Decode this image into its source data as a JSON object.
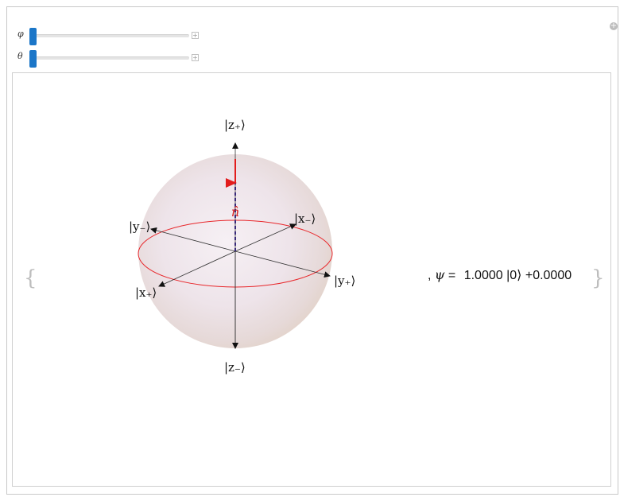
{
  "controls": {
    "phi": {
      "label": "φ",
      "value": 0
    },
    "theta": {
      "label": "θ",
      "value": 0
    }
  },
  "output": {
    "open_brace": "{",
    "close_brace": "}",
    "psi_prefix": ",",
    "psi_symbol": "ψ",
    "equals": "=",
    "coef_0": "1.0000",
    "ket_0": "|0⟩",
    "plus": "+",
    "coef_1": "0.0000"
  },
  "bloch": {
    "z_plus": "|z₊⟩",
    "z_minus": "|z₋⟩",
    "x_plus": "|x₊⟩",
    "x_minus": "|x₋⟩",
    "y_plus": "|y₊⟩",
    "y_minus": "|y₋⟩",
    "n_hat": "n̂"
  },
  "colors": {
    "slider_thumb": "#1b76c8",
    "equator": "#e8262a",
    "state_vector": "#d81e1e",
    "n_dashed": "#3a2a7a"
  }
}
